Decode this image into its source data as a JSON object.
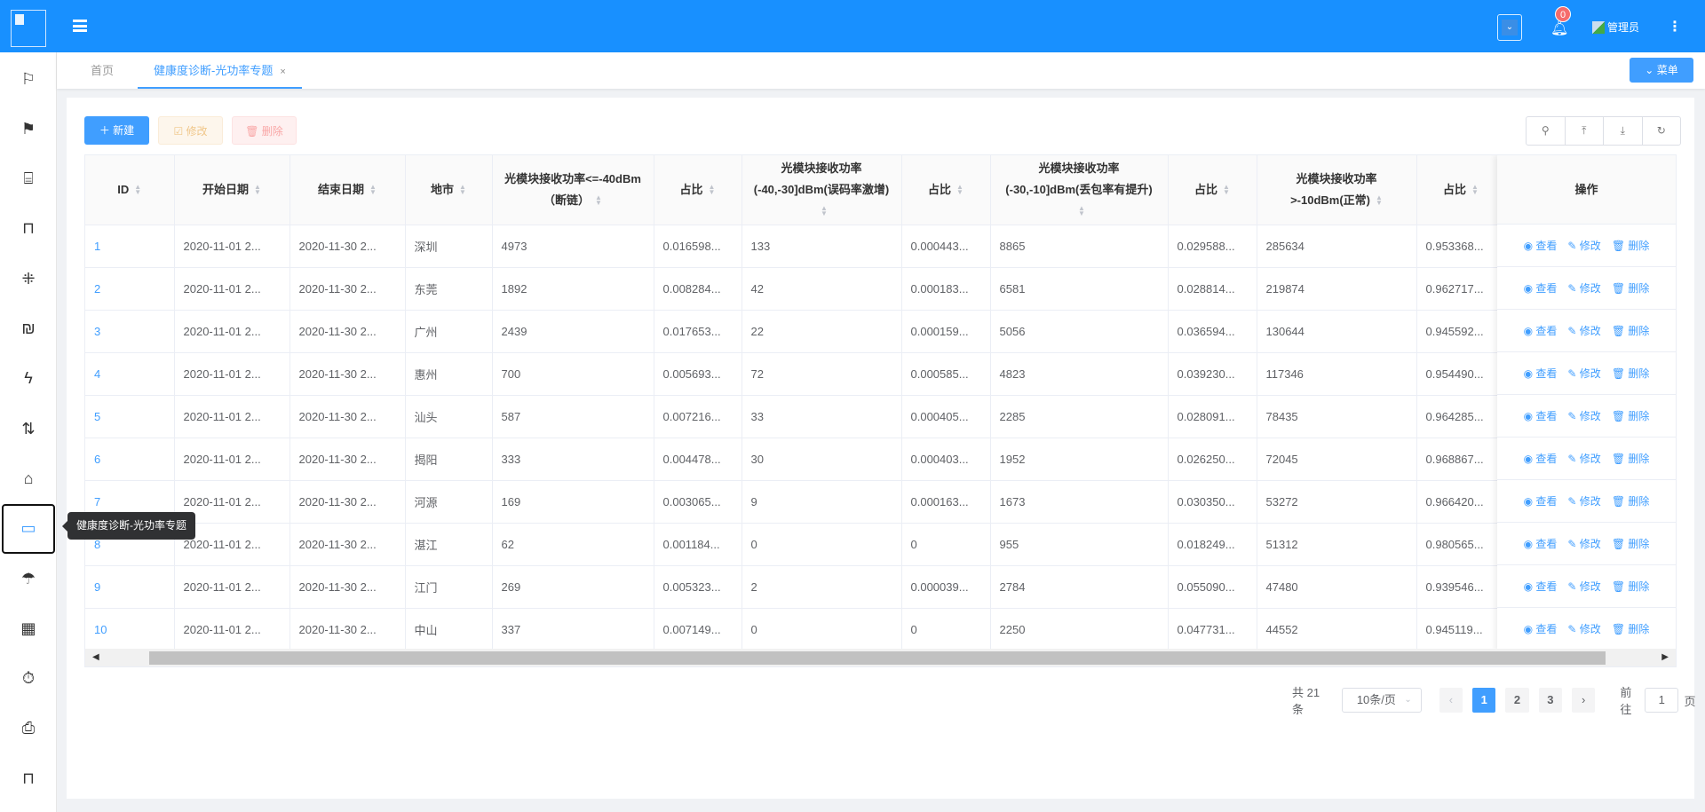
{
  "header": {
    "notification_count": "0",
    "user_name": "管理员"
  },
  "tabs": [
    {
      "label": "首页"
    },
    {
      "label": "健康度诊断-光功率专题",
      "close": "×"
    }
  ],
  "menu_button": "菜单",
  "sidebar": {
    "tooltip": "健康度诊断-光功率专题",
    "icons": [
      "flag-outline-icon",
      "flag-filled-icon",
      "presentation-chart-icon",
      "presentation-icon",
      "sparkle-icon",
      "shekel-icon",
      "lightning-icon",
      "sort-arrows-icon",
      "home-icon",
      "video-camera-icon",
      "umbrella-icon",
      "grid-icon",
      "stopwatch-icon",
      "inbox-icon",
      "board-icon"
    ],
    "active_index": 9
  },
  "toolbar": {
    "new": "新建",
    "edit": "修改",
    "delete": "删除"
  },
  "table": {
    "columns": [
      "ID",
      "开始日期",
      "结束日期",
      "地市",
      "光模块接收功率<=-40dBm（断链）",
      "占比",
      "光模块接收功率(-40,-30]dBm(误码率激增)",
      "占比",
      "光模块接收功率(-30,-10]dBm(丢包率有提升)",
      "占比",
      "光模块接收功率>-10dBm(正常)",
      "占比"
    ],
    "action_header": "操作",
    "actions": {
      "view": "查看",
      "edit": "修改",
      "delete": "删除"
    },
    "rows": [
      [
        "1",
        "2020-11-01 2...",
        "2020-11-30 2...",
        "深圳",
        "4973",
        "0.016598...",
        "133",
        "0.000443...",
        "8865",
        "0.029588...",
        "285634",
        "0.953368..."
      ],
      [
        "2",
        "2020-11-01 2...",
        "2020-11-30 2...",
        "东莞",
        "1892",
        "0.008284...",
        "42",
        "0.000183...",
        "6581",
        "0.028814...",
        "219874",
        "0.962717..."
      ],
      [
        "3",
        "2020-11-01 2...",
        "2020-11-30 2...",
        "广州",
        "2439",
        "0.017653...",
        "22",
        "0.000159...",
        "5056",
        "0.036594...",
        "130644",
        "0.945592..."
      ],
      [
        "4",
        "2020-11-01 2...",
        "2020-11-30 2...",
        "惠州",
        "700",
        "0.005693...",
        "72",
        "0.000585...",
        "4823",
        "0.039230...",
        "117346",
        "0.954490..."
      ],
      [
        "5",
        "2020-11-01 2...",
        "2020-11-30 2...",
        "汕头",
        "587",
        "0.007216...",
        "33",
        "0.000405...",
        "2285",
        "0.028091...",
        "78435",
        "0.964285..."
      ],
      [
        "6",
        "2020-11-01 2...",
        "2020-11-30 2...",
        "揭阳",
        "333",
        "0.004478...",
        "30",
        "0.000403...",
        "1952",
        "0.026250...",
        "72045",
        "0.968867..."
      ],
      [
        "7",
        "2020-11-01 2...",
        "2020-11-30 2...",
        "河源",
        "169",
        "0.003065...",
        "9",
        "0.000163...",
        "1673",
        "0.030350...",
        "53272",
        "0.966420..."
      ],
      [
        "8",
        "2020-11-01 2...",
        "2020-11-30 2...",
        "湛江",
        "62",
        "0.001184...",
        "0",
        "0",
        "955",
        "0.018249...",
        "51312",
        "0.980565..."
      ],
      [
        "9",
        "2020-11-01 2...",
        "2020-11-30 2...",
        "江门",
        "269",
        "0.005323...",
        "2",
        "0.000039...",
        "2784",
        "0.055090...",
        "47480",
        "0.939546..."
      ],
      [
        "10",
        "2020-11-01 2...",
        "2020-11-30 2...",
        "中山",
        "337",
        "0.007149...",
        "0",
        "0",
        "2250",
        "0.047731...",
        "44552",
        "0.945119..."
      ]
    ]
  },
  "pagination": {
    "total": "共 21 条",
    "page_size": "10条/页",
    "pages": [
      "1",
      "2",
      "3"
    ],
    "current": "1",
    "goto_label": "前往",
    "goto_value": "1",
    "page_unit": "页"
  }
}
